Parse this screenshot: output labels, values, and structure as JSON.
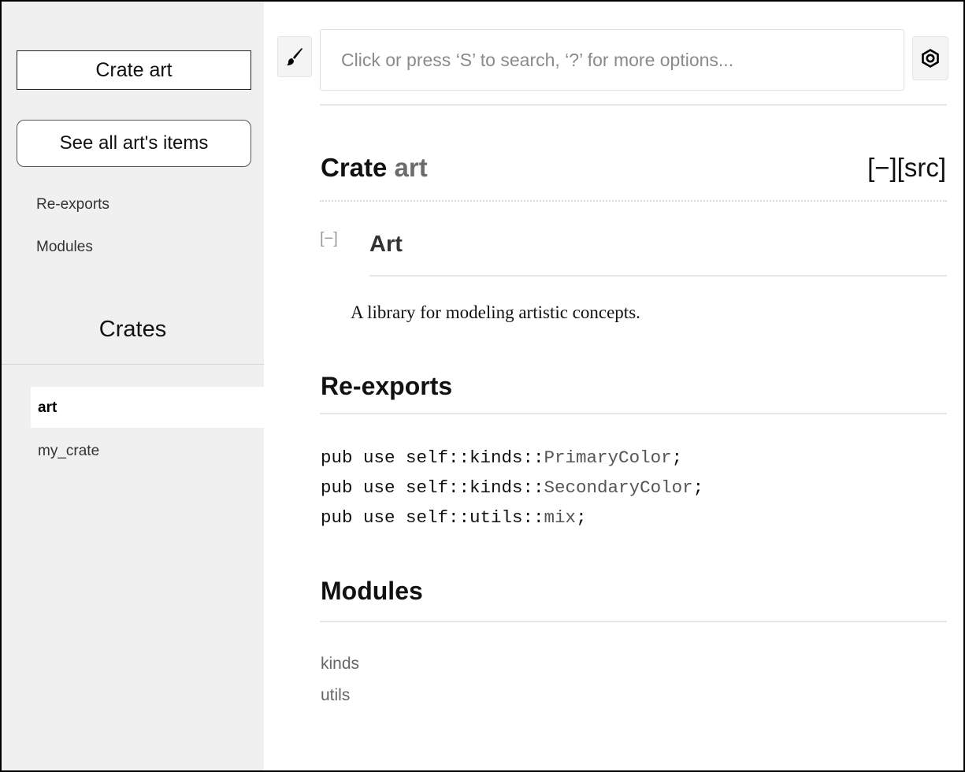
{
  "sidebar": {
    "crate_title": "Crate art",
    "see_all_label": "See all art's items",
    "links": [
      {
        "label": "Re-exports"
      },
      {
        "label": "Modules"
      }
    ],
    "crates_heading": "Crates",
    "crates": [
      {
        "label": "art",
        "active": true
      },
      {
        "label": "my_crate",
        "active": false
      }
    ]
  },
  "toolbar": {
    "theme_icon": "paintbrush-icon",
    "search_placeholder": "Click or press ‘S’ to search, ‘?’ for more options...",
    "settings_icon": "gear-icon"
  },
  "main": {
    "title_prefix": "Crate",
    "title_name": "art",
    "collapse_toggle": "[−]",
    "src_link": "[src]",
    "doc_toggle": "[−]",
    "doc_heading": "Art",
    "doc_description": "A library for modeling artistic concepts.",
    "reexports": {
      "heading": "Re-exports",
      "lines": [
        {
          "prefix": "pub use self::kinds::",
          "item": "PrimaryColor",
          "suffix": ";"
        },
        {
          "prefix": "pub use self::kinds::",
          "item": "SecondaryColor",
          "suffix": ";"
        },
        {
          "prefix": "pub use self::utils::",
          "item": "mix",
          "suffix": ";"
        }
      ]
    },
    "modules": {
      "heading": "Modules",
      "items": [
        {
          "label": "kinds"
        },
        {
          "label": "utils"
        }
      ]
    }
  },
  "colors": {
    "sidebar_bg": "#f0f0f0",
    "crate_name_gray": "#6b6b6b",
    "link_gray": "#666666"
  }
}
